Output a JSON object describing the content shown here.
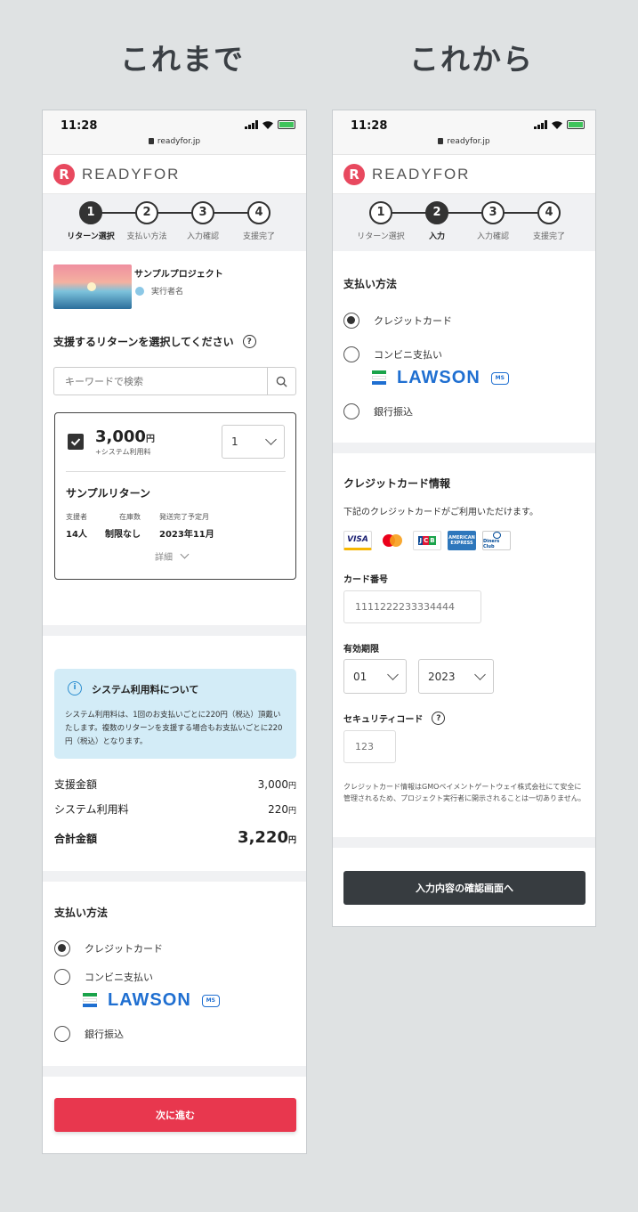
{
  "headings": {
    "before": "これまで",
    "after": "これから"
  },
  "status": {
    "time": "11:28",
    "url": "readyfor.jp"
  },
  "brand": {
    "mark": "R",
    "name": "READYFOR"
  },
  "before": {
    "steps": [
      {
        "num": "1",
        "label": "リターン選択",
        "active": true
      },
      {
        "num": "2",
        "label": "支払い方法",
        "active": false
      },
      {
        "num": "3",
        "label": "入力確認",
        "active": false
      },
      {
        "num": "4",
        "label": "支援完了",
        "active": false
      }
    ],
    "project": {
      "name": "サンプルプロジェクト",
      "owner": "実行者名"
    },
    "select_title": "支援するリターンを選択してください",
    "search_placeholder": "キーワードで検索",
    "return_card": {
      "price": "3,000",
      "yen": "円",
      "fee_note": "+システム利用料",
      "qty": "1",
      "name": "サンプルリターン",
      "stats": [
        {
          "label": "支援者",
          "value": "14人"
        },
        {
          "label": "在庫数",
          "value": "制限なし"
        },
        {
          "label": "発送完了予定月",
          "value": "2023年11月"
        }
      ],
      "details": "詳細"
    },
    "info": {
      "title": "システム利用料について",
      "body": "システム利用料は、1回のお支払いごとに220円（税込）頂戴いたします。複数のリターンを支援する場合もお支払いごとに220円（税込）となります。"
    },
    "totals": [
      {
        "label": "支援金額",
        "value": "3,000",
        "unit": "円"
      },
      {
        "label": "システム利用料",
        "value": "220",
        "unit": "円"
      },
      {
        "label": "合計金額",
        "value": "3,220",
        "unit": "円"
      }
    ],
    "payment_title": "支払い方法",
    "payment_options": [
      "クレジットカード",
      "コンビニ支払い",
      "銀行振込"
    ],
    "next_button": "次に進む"
  },
  "after": {
    "steps": [
      {
        "num": "1",
        "label": "リターン選択",
        "active": false
      },
      {
        "num": "2",
        "label": "入力",
        "active": true
      },
      {
        "num": "3",
        "label": "入力確認",
        "active": false
      },
      {
        "num": "4",
        "label": "支援完了",
        "active": false
      }
    ],
    "payment_title": "支払い方法",
    "payment_options": [
      "クレジットカード",
      "コンビニ支払い",
      "銀行振込"
    ],
    "lawson_text": "LAWSON",
    "card_section": {
      "title": "クレジットカード情報",
      "note": "下記のクレジットカードがご利用いただけます。",
      "brands": [
        "VISA",
        "mastercard",
        "JCB",
        "AMERICAN EXPRESS",
        "Diners Club"
      ],
      "card_number_label": "カード番号",
      "card_number_placeholder": "1111222233334444",
      "expiry_label": "有効期限",
      "expiry_month": "01",
      "expiry_year": "2023",
      "cvc_label": "セキュリティコード",
      "cvc_placeholder": "123",
      "disclaimer": "クレジットカード情報はGMOペイメントゲートウェイ株式会社にて安全に管理されるため、プロジェクト実行者に開示されることは一切ありません。"
    },
    "confirm_button": "入力内容の確認画面へ"
  },
  "colors": {
    "primary_red": "#e8374e",
    "dark_button": "#373c40",
    "lawson_blue": "#1f6fd1",
    "info_bg": "#d3ecf7"
  }
}
